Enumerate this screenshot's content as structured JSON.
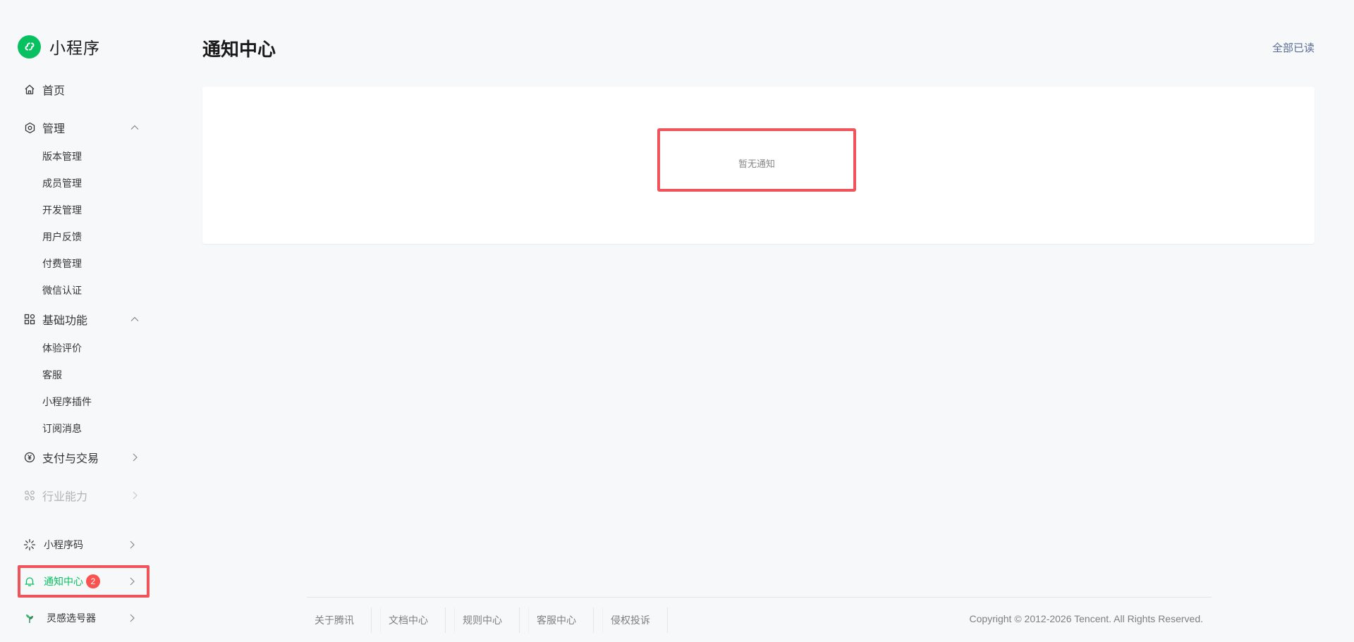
{
  "brand": {
    "name": "小程序",
    "icon": "mini-program-logo-icon",
    "color": "#07c160"
  },
  "nav": {
    "home": {
      "label": "首页",
      "icon": "home-icon"
    },
    "manage": {
      "label": "管理",
      "icon": "hexagon-settings-icon",
      "items": [
        "版本管理",
        "成员管理",
        "开发管理",
        "用户反馈",
        "付费管理",
        "微信认证"
      ]
    },
    "basic": {
      "label": "基础功能",
      "icon": "grid-icon",
      "items": [
        "体验评价",
        "客服",
        "小程序插件",
        "订阅消息"
      ]
    },
    "payment": {
      "label": "支付与交易",
      "icon": "yuan-icon"
    },
    "industry": {
      "label": "行业能力",
      "icon": "nodes-icon"
    },
    "qrcode": {
      "label": "小程序码",
      "icon": "sun-burst-icon"
    },
    "notifications": {
      "label": "通知中心",
      "icon": "bell-icon",
      "badge": "2"
    },
    "inspiration": {
      "label": "灵感选号器",
      "icon": "sprout-icon"
    }
  },
  "main": {
    "title": "通知中心",
    "mark_all_read": "全部已读",
    "empty_text": "暂无通知"
  },
  "footer": {
    "links": [
      "关于腾讯",
      "文档中心",
      "规则中心",
      "客服中心",
      "侵权投诉"
    ],
    "copyright": "Copyright © 2012-2026 Tencent. All Rights Reserved."
  },
  "colors": {
    "accent": "#07c160",
    "link": "#576b95",
    "badge": "#fa5151",
    "highlight": "#f0535a"
  }
}
